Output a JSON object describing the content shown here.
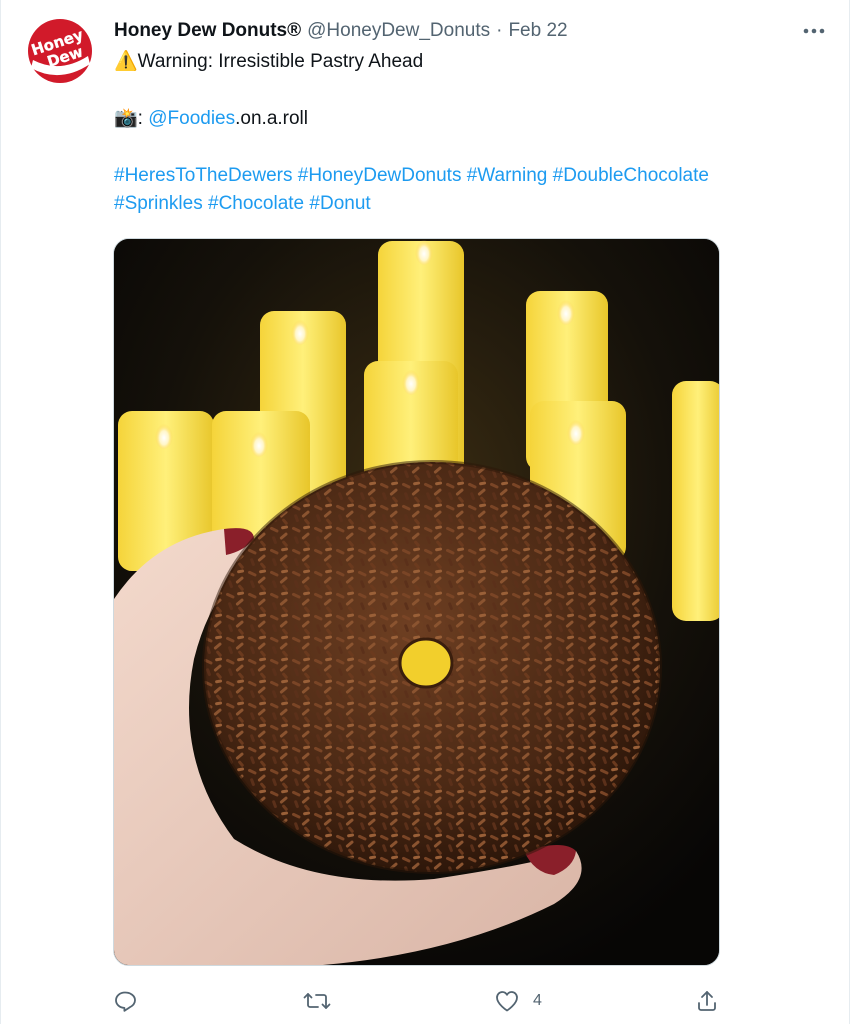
{
  "author": {
    "display_name": "Honey Dew Donuts®",
    "handle": "@HoneyDew_Donuts",
    "separator": "·",
    "date": "Feb 22",
    "avatar_logo_text_line1": "Honey",
    "avatar_logo_text_line2": "Dew",
    "avatar_icon": "honey-dew-logo"
  },
  "tweet": {
    "line1_emoji": "⚠️",
    "line1_text": "Warning: Irresistible Pastry Ahead",
    "line2_emoji": "📸",
    "line2_colon": ":",
    "line2_mention": "@Foodies",
    "line2_suffix": ".on.a.roll",
    "hashtags_row1": [
      "#HeresToTheDewers",
      "#HoneyDewDonuts",
      "#Warning",
      "#DoubleChocolate"
    ],
    "hashtags_row2": [
      "#Sprinkles",
      "#Chocolate",
      "#Donut"
    ]
  },
  "media": {
    "subject": "chocolate sprinkle donut held in hand in front of candles"
  },
  "actions": {
    "reply_icon": "reply-icon",
    "retweet_icon": "retweet-icon",
    "like_icon": "like-icon",
    "like_count": "4",
    "share_icon": "share-icon",
    "more_icon": "more-icon"
  },
  "colors": {
    "link": "#1d9bf0",
    "secondary_text": "#536471",
    "primary_text": "#0f1419",
    "brand_red": "#c8102e"
  }
}
